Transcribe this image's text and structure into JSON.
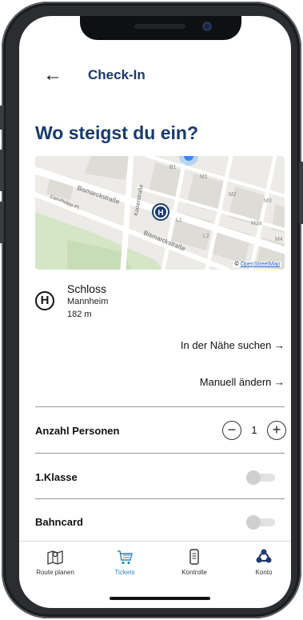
{
  "header": {
    "title": "Check-In"
  },
  "page_title": "Wo steigst du ein?",
  "map": {
    "street_labels": [
      "Bismarckstraße",
      "Bismarckstraße",
      "Carl-Philipp-Pl.",
      "Kaiserstraße"
    ],
    "block_labels": [
      "B1",
      "M1",
      "M2",
      "M3",
      "M3a",
      "M4",
      "L1",
      "L2"
    ],
    "stop_marker": "H",
    "attribution_prefix": "©",
    "attribution_link": "OpenStreetMap"
  },
  "station": {
    "icon": "H",
    "name": "Schloss",
    "city": "Mannheim",
    "distance": "182 m"
  },
  "links": {
    "nearby": "In der Nähe suchen →",
    "manual": "Manuell ändern →"
  },
  "options": {
    "persons_label": "Anzahl Personen",
    "persons_value": "1",
    "minus": "−",
    "plus": "+",
    "first_class_label": "1.Klasse",
    "first_class_on": false,
    "bahncard_label": "Bahncard",
    "bahncard_on": false
  },
  "tabs": [
    {
      "label": "Route planen",
      "icon": "map-icon",
      "active": false
    },
    {
      "label": "Tickets",
      "icon": "cart-icon",
      "active": true
    },
    {
      "label": "Kontrolle",
      "icon": "phone-ticket-icon",
      "active": false
    },
    {
      "label": "Konto",
      "icon": "account-icon",
      "active": false
    }
  ],
  "colors": {
    "title": "#173a6b",
    "active_tab": "#2a86c8",
    "marker": "#1f3a6e"
  }
}
